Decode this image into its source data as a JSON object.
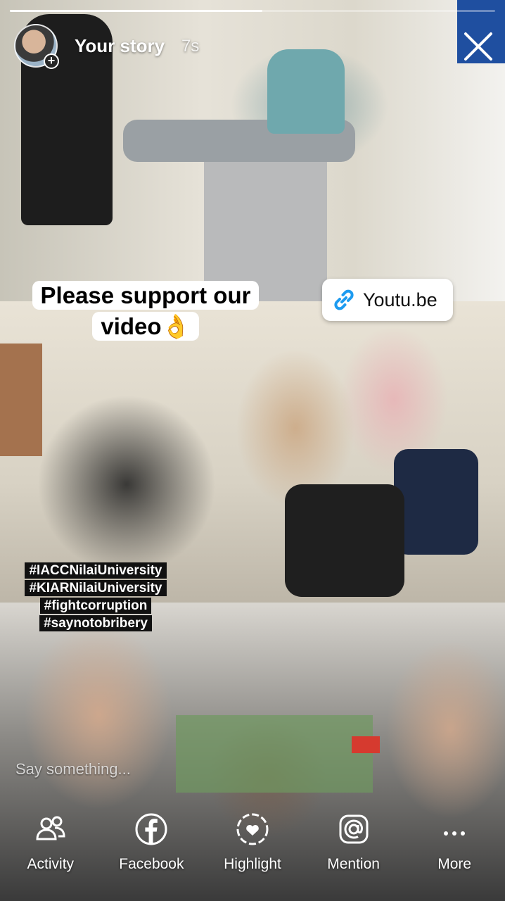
{
  "story": {
    "title": "Your story",
    "time": "7s",
    "progress": 0.52
  },
  "stickers": {
    "caption_lines": [
      "Please support our",
      "video👌"
    ],
    "link_label": "Youtu.be",
    "hashtags": [
      "#IACCNilaiUniversity",
      "#KIARNilaiUniversity",
      "#fightcorruption",
      "#saynotobribery"
    ]
  },
  "reply": {
    "placeholder": "Say something..."
  },
  "actions": [
    {
      "label": "Activity",
      "icon": "activity-icon"
    },
    {
      "label": "Facebook",
      "icon": "facebook-icon"
    },
    {
      "label": "Highlight",
      "icon": "highlight-icon"
    },
    {
      "label": "Mention",
      "icon": "mention-icon"
    },
    {
      "label": "More",
      "icon": "more-icon"
    }
  ],
  "colors": {
    "text": "#ffffff",
    "sticker_bg": "#ffffff",
    "link_icon": "#1d9bf0"
  }
}
